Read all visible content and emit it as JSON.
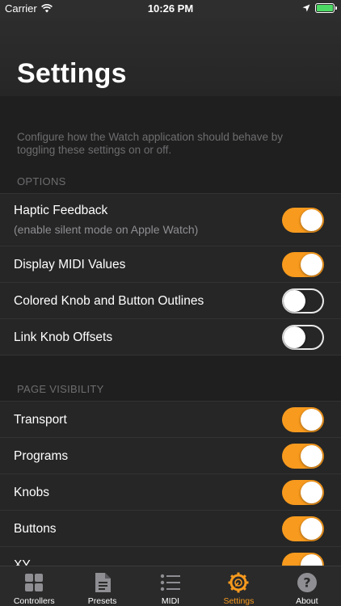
{
  "status_bar": {
    "carrier": "Carrier",
    "time": "10:26 PM",
    "battery_color": "#4cd964"
  },
  "header": {
    "title": "Settings"
  },
  "intro_text": "Configure how the Watch application should behave by toggling these settings on or off.",
  "options": {
    "header": "OPTIONS",
    "items": [
      {
        "label": "Haptic Feedback",
        "sublabel": "(enable silent mode on Apple Watch)",
        "on": true
      },
      {
        "label": "Display MIDI Values",
        "on": true
      },
      {
        "label": "Colored Knob and Button Outlines",
        "on": false
      },
      {
        "label": "Link Knob Offsets",
        "on": false
      }
    ]
  },
  "page_visibility": {
    "header": "PAGE VISIBILITY",
    "items": [
      {
        "label": "Transport",
        "on": true
      },
      {
        "label": "Programs",
        "on": true
      },
      {
        "label": "Knobs",
        "on": true
      },
      {
        "label": "Buttons",
        "on": true
      },
      {
        "label": "XY",
        "on": true
      }
    ]
  },
  "tab_bar": {
    "active_color": "#f79a1e",
    "tabs": [
      {
        "label": "Controllers",
        "icon": "grid-icon",
        "active": false
      },
      {
        "label": "Presets",
        "icon": "document-icon",
        "active": false
      },
      {
        "label": "MIDI",
        "icon": "list-icon",
        "active": false
      },
      {
        "label": "Settings",
        "icon": "gear-icon",
        "active": true
      },
      {
        "label": "About",
        "icon": "question-icon",
        "active": false
      }
    ]
  }
}
